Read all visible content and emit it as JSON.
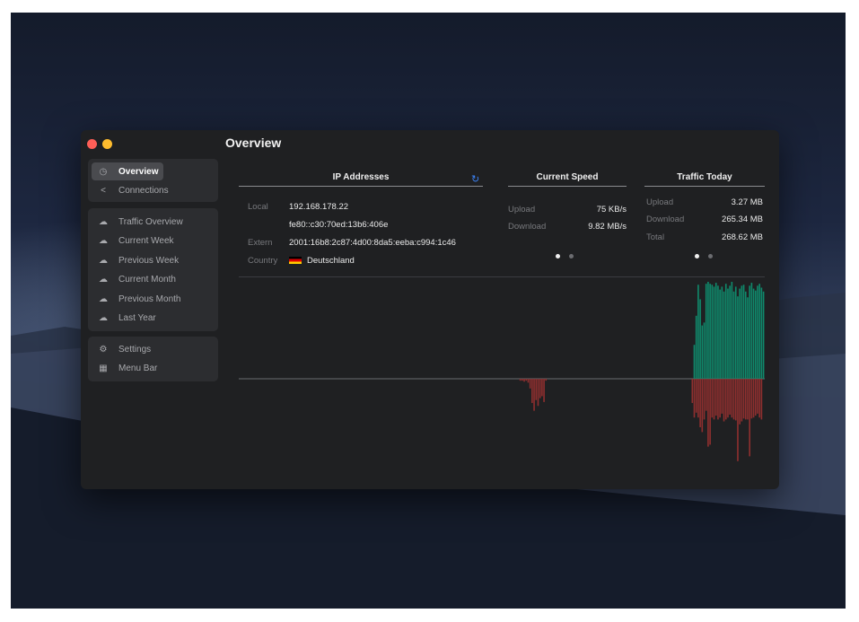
{
  "window": {
    "title": "Overview"
  },
  "sidebar": {
    "group1": [
      {
        "label": "Overview",
        "icon": "speedometer-icon",
        "active": true
      },
      {
        "label": "Connections",
        "icon": "share-icon",
        "active": false
      }
    ],
    "group2": [
      {
        "label": "Traffic Overview",
        "icon": "cloud-icon"
      },
      {
        "label": "Current Week",
        "icon": "cloud-icon"
      },
      {
        "label": "Previous Week",
        "icon": "cloud-icon"
      },
      {
        "label": "Current Month",
        "icon": "cloud-icon"
      },
      {
        "label": "Previous Month",
        "icon": "cloud-icon"
      },
      {
        "label": "Last Year",
        "icon": "cloud-icon"
      }
    ],
    "group3": [
      {
        "label": "Settings",
        "icon": "gear-icon"
      },
      {
        "label": "Menu Bar",
        "icon": "menu-bar-icon"
      }
    ]
  },
  "ip": {
    "heading": "IP Addresses",
    "local_label": "Local",
    "local_v4": "192.168.178.22",
    "local_v6": "fe80::c30:70ed:13b6:406e",
    "extern_label": "Extern",
    "extern_value": "2001:16b8:2c87:4d00:8da5:eeba:c994:1c46",
    "country_label": "Country",
    "country_value": "Deutschland"
  },
  "speed": {
    "heading": "Current Speed",
    "upload_label": "Upload",
    "upload_value": "75 KB/s",
    "download_label": "Download",
    "download_value": "9.82 MB/s"
  },
  "traffic": {
    "heading": "Traffic Today",
    "upload_label": "Upload",
    "upload_value": "3.27 MB",
    "download_label": "Download",
    "download_value": "265.34 MB",
    "total_label": "Total",
    "total_value": "268.62 MB"
  },
  "colors": {
    "upload": "#0f8a6c",
    "download": "#8f2f2f",
    "accent": "#3b82f6"
  },
  "chart_data": {
    "type": "bar",
    "xlabel": "",
    "ylabel": "",
    "series": [
      {
        "values_up": [
          0,
          0,
          0,
          0,
          0,
          0,
          0,
          0,
          0,
          0,
          0,
          0,
          0,
          0,
          0,
          0,
          0,
          0,
          0,
          0,
          0,
          0,
          0,
          0,
          0,
          0,
          0,
          0,
          0,
          0,
          0,
          0,
          0,
          0,
          0,
          0,
          0,
          0,
          0,
          0,
          0,
          0,
          0,
          0,
          0,
          0,
          0,
          0,
          0,
          0,
          0,
          0,
          0,
          0,
          0,
          0,
          0,
          0,
          0,
          0,
          0,
          0,
          0,
          0,
          0,
          0,
          0,
          0,
          0,
          0,
          0,
          0,
          0,
          0,
          0,
          0,
          0,
          0,
          0,
          0,
          0,
          0,
          0,
          0,
          0,
          0,
          0,
          0,
          0,
          0,
          0,
          0,
          0,
          0,
          0,
          0,
          0,
          0,
          0,
          0,
          0,
          0,
          0,
          0,
          0,
          0,
          0,
          0,
          0,
          0,
          0,
          0,
          0,
          0,
          0,
          0,
          0,
          0,
          0,
          0,
          0,
          0,
          0,
          0,
          0,
          0,
          0,
          0,
          0,
          0,
          0,
          0,
          0,
          0,
          0,
          0,
          0,
          0,
          0,
          0,
          0,
          0,
          0,
          0,
          0,
          0,
          0,
          0,
          0,
          0,
          0,
          0,
          0,
          0,
          0,
          0,
          0,
          0,
          0,
          0,
          0,
          0,
          0,
          0,
          0,
          0,
          0,
          0,
          0,
          0,
          0,
          0,
          0,
          0,
          0,
          0,
          0,
          0,
          0,
          0,
          0,
          0,
          0,
          0,
          0,
          0,
          0,
          0,
          0,
          0,
          0,
          0,
          0,
          0,
          0,
          0,
          0,
          0,
          0,
          0,
          0,
          0,
          0,
          0,
          0,
          0,
          0,
          0,
          0,
          0,
          0,
          0,
          0,
          0,
          0,
          0,
          0,
          0,
          0,
          0,
          0,
          0,
          0,
          0,
          0,
          0,
          0,
          0,
          0,
          0,
          0.35,
          0.65,
          0.97,
          0.82,
          0.55,
          0.58,
          0.98,
          1.0,
          0.98,
          0.97,
          0.95,
          0.99,
          0.96,
          0.92,
          0.95,
          0.9,
          0.98,
          0.93,
          0.96,
          1.0,
          0.9,
          0.95,
          0.85,
          0.93,
          0.96,
          0.97,
          0.9,
          0.84,
          0.96,
          0.99,
          0.93,
          0.91,
          0.96,
          0.98,
          0.94,
          0.9
        ],
        "values_down": [
          0,
          0,
          0,
          0,
          0,
          0,
          0,
          0,
          0,
          0,
          0,
          0,
          0,
          0,
          0,
          0,
          0,
          0,
          0,
          0,
          0,
          0,
          0,
          0,
          0,
          0,
          0,
          0,
          0,
          0,
          0,
          0,
          0,
          0,
          0,
          0,
          0,
          0,
          0,
          0,
          0,
          0,
          0,
          0,
          0,
          0,
          0,
          0,
          0,
          0,
          0,
          0,
          0,
          0,
          0,
          0,
          0,
          0,
          0,
          0,
          0,
          0,
          0,
          0,
          0,
          0,
          0,
          0,
          0,
          0,
          0,
          0,
          0,
          0,
          0,
          0,
          0,
          0,
          0,
          0,
          0,
          0,
          0,
          0,
          0,
          0,
          0,
          0,
          0,
          0,
          0,
          0,
          0,
          0,
          0,
          0,
          0,
          0,
          0,
          0,
          0,
          0,
          0,
          0,
          0,
          0,
          0,
          0,
          0,
          0,
          0,
          0,
          0,
          0,
          0,
          0,
          0,
          0,
          0,
          0,
          0,
          0,
          0,
          0,
          0,
          0,
          0,
          0,
          0,
          0,
          0,
          0,
          0,
          0,
          0,
          0,
          0,
          0,
          0,
          0,
          0,
          0,
          0.02,
          0.02,
          0.03,
          0.02,
          0.04,
          0.1,
          0.25,
          0.33,
          0.22,
          0.28,
          0.2,
          0.18,
          0.24,
          0.02,
          0.0,
          0,
          0,
          0,
          0,
          0,
          0,
          0,
          0,
          0,
          0,
          0,
          0,
          0,
          0,
          0,
          0,
          0,
          0,
          0,
          0,
          0,
          0,
          0,
          0,
          0,
          0,
          0,
          0,
          0,
          0,
          0,
          0,
          0,
          0,
          0,
          0,
          0,
          0,
          0,
          0,
          0,
          0,
          0,
          0,
          0,
          0,
          0,
          0,
          0,
          0,
          0,
          0,
          0,
          0,
          0,
          0,
          0,
          0,
          0,
          0,
          0,
          0,
          0,
          0,
          0,
          0,
          0,
          0,
          0,
          0,
          0,
          0,
          0.25,
          0.4,
          0.35,
          0.4,
          0.5,
          0.55,
          0.42,
          0.33,
          0.7,
          0.68,
          0.4,
          0.42,
          0.38,
          0.42,
          0.4,
          0.36,
          0.44,
          0.42,
          0.4,
          0.37,
          0.4,
          0.42,
          0.43,
          0.85,
          0.47,
          0.44,
          0.41,
          0.42,
          0.42,
          0.8,
          0.41,
          0.4,
          0.38,
          0.36,
          0.4,
          0.42
        ]
      }
    ]
  }
}
